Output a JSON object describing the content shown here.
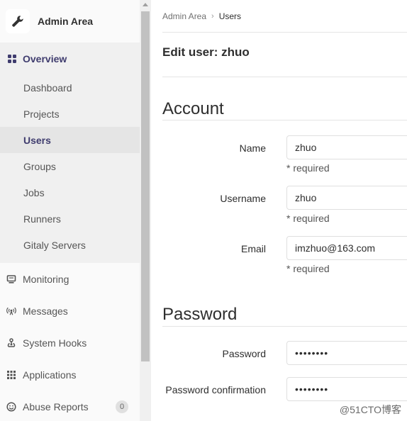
{
  "sidebar": {
    "title": "Admin Area",
    "header_icon": "wrench-icon",
    "overview": {
      "label": "Overview",
      "icon": "grid-icon"
    },
    "overview_items": [
      {
        "label": "Dashboard"
      },
      {
        "label": "Projects"
      },
      {
        "label": "Users",
        "active": true
      },
      {
        "label": "Groups"
      },
      {
        "label": "Jobs"
      },
      {
        "label": "Runners"
      },
      {
        "label": "Gitaly Servers"
      }
    ],
    "items": [
      {
        "label": "Monitoring",
        "icon": "monitor-icon"
      },
      {
        "label": "Messages",
        "icon": "broadcast-icon"
      },
      {
        "label": "System Hooks",
        "icon": "hook-icon"
      },
      {
        "label": "Applications",
        "icon": "apps-grid-icon"
      },
      {
        "label": "Abuse Reports",
        "icon": "smiley-icon",
        "badge": "0"
      }
    ]
  },
  "breadcrumb": {
    "parent": "Admin Area",
    "current": "Users"
  },
  "page_title": "Edit user: zhuo",
  "account": {
    "title": "Account",
    "name": {
      "label": "Name",
      "value": "zhuo",
      "help": "* required"
    },
    "username": {
      "label": "Username",
      "value": "zhuo",
      "help": "* required"
    },
    "email": {
      "label": "Email",
      "value": "imzhuo@163.com",
      "help": "* required"
    }
  },
  "password": {
    "title": "Password",
    "password": {
      "label": "Password",
      "value": "••••••••"
    },
    "confirmation": {
      "label": "Password confirmation",
      "value": "••••••••"
    }
  },
  "watermark": "@51CTO博客"
}
